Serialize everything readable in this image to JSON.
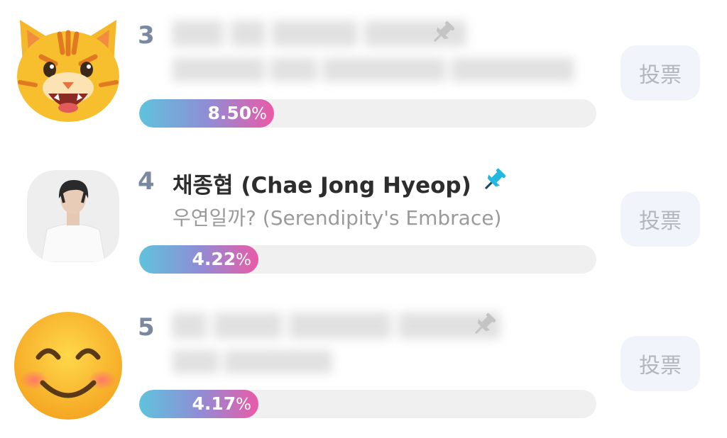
{
  "entries": [
    {
      "rank": "3",
      "name": "",
      "song": "",
      "percent": "8.50",
      "percent_sign": "%",
      "fraction": 0.085,
      "avatar": "tiger-face-emoji",
      "vote_label": "投票",
      "pinned_color": "#c4c4c4"
    },
    {
      "rank": "4",
      "name": "채종협 (Chae Jong Hyeop)",
      "song": "우연일까? (Serendipity's Embrace)",
      "percent": "4.22",
      "percent_sign": "%",
      "fraction": 0.0422,
      "avatar": "profile-photo",
      "vote_label": "投票",
      "pinned_color": "#22b8e0"
    },
    {
      "rank": "5",
      "name": "",
      "song": "",
      "percent": "4.17",
      "percent_sign": "%",
      "fraction": 0.0417,
      "avatar": "smiling-face-emoji",
      "vote_label": "投票",
      "pinned_color": "#c4c4c4"
    }
  ],
  "colors": {
    "bar_gradient": [
      "#5fc3dc",
      "#8e8ed6",
      "#ea5aa7"
    ],
    "track": "#f0f0f1",
    "rank": "#7a88a0",
    "vote_bg": "#f1f5fb",
    "vote_text": "#b2b6bd"
  }
}
